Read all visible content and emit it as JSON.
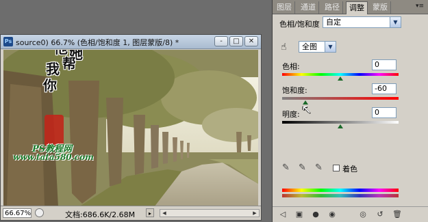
{
  "document": {
    "icon": "Ps",
    "title": "source0",
    "title_suffix": ") 66.7% (色相/饱和度 1, 图层蒙版/8) *",
    "zoom": "66.67%",
    "doc_info": "文档:686.6K/2.68M",
    "buttons": {
      "minimize": "-",
      "restore": "□",
      "close": "✕"
    }
  },
  "watermark": {
    "chars": [
      "他",
      "她",
      "帮",
      "我",
      "你"
    ],
    "site_line1": "PS教程网",
    "site_line2": "www.tata580.com"
  },
  "panel": {
    "tabs": [
      "图层",
      "通道",
      "路径",
      "调整",
      "蒙版"
    ],
    "active_tab": 3,
    "title": "色相/饱和度",
    "preset": "自定",
    "channel": "全图",
    "hue_label": "色相:",
    "hue_value": "0",
    "saturation_label": "饱和度:",
    "saturation_value": "-60",
    "lightness_label": "明度:",
    "lightness_value": "0",
    "colorize_label": "着色"
  },
  "sliders": {
    "hue": 0.5,
    "saturation": 0.2,
    "lightness": 0.5
  },
  "icons": {
    "hand": "hand-adjust-icon",
    "eyedroppers": [
      "eyedropper-icon",
      "eyedropper-plus-icon",
      "eyedropper-minus-icon"
    ]
  }
}
